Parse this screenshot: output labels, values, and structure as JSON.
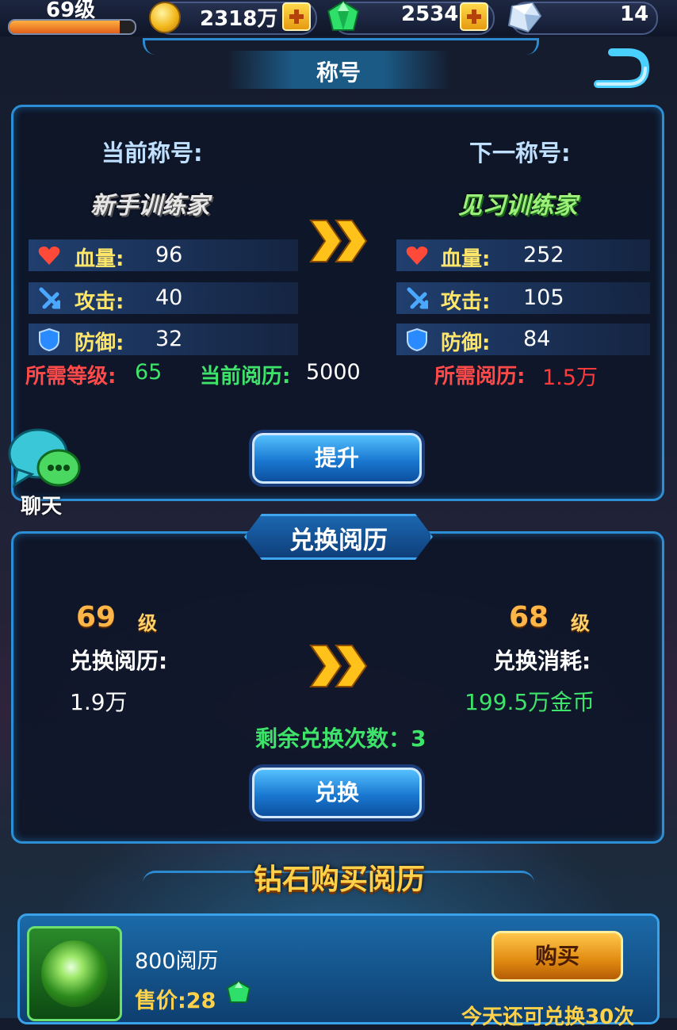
{
  "top": {
    "level": "69级",
    "level_progress": 0.88,
    "gold": "2318万",
    "gems": "2534",
    "crystals": "14"
  },
  "header": {
    "title": "称号"
  },
  "title_panel": {
    "current_label": "当前称号:",
    "next_label": "下一称号:",
    "current_title": "新手训练家",
    "next_title": "见习训练家",
    "stats_current": [
      {
        "name": "血量:",
        "value": "96",
        "icon": "heart-icon"
      },
      {
        "name": "攻击:",
        "value": "40",
        "icon": "sword-icon"
      },
      {
        "name": "防御:",
        "value": "32",
        "icon": "shield-icon"
      }
    ],
    "stats_next": [
      {
        "name": "血量:",
        "value": "252",
        "icon": "heart-icon"
      },
      {
        "name": "攻击:",
        "value": "105",
        "icon": "sword-icon"
      },
      {
        "name": "防御:",
        "value": "84",
        "icon": "shield-icon"
      }
    ],
    "req_level_label": "所需等级:",
    "req_level_value": "65",
    "cur_exp_label": "当前阅历:",
    "cur_exp_value": "5000",
    "req_exp_label": "所需阅历:",
    "req_exp_value": "1.5万",
    "upgrade_button": "提升"
  },
  "chat": {
    "label": "聊天"
  },
  "exchange_panel": {
    "title": "兑换阅历",
    "left_level": "69",
    "right_level": "68",
    "level_unit": "级",
    "exchange_exp_label": "兑换阅历:",
    "exchange_exp_value": "1.9万",
    "cost_label": "兑换消耗:",
    "cost_value": "199.5万金币",
    "remaining": "剩余兑换次数：3",
    "exchange_button": "兑换"
  },
  "diamond_section": {
    "banner": "钻石购买阅历",
    "item_name": "800阅历",
    "price": "售价:28",
    "buy_button": "购买",
    "footnote": "今天还可兑换30次"
  },
  "colors": {
    "accent_blue": "#2c8ed4",
    "green_text": "#3ee46a",
    "red_text": "#ff3a3a",
    "label_yellow": "#ffe66a"
  }
}
